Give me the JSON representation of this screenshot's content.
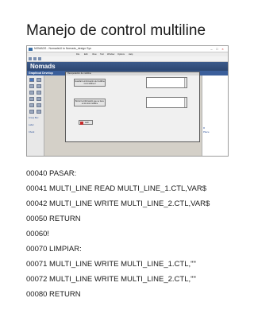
{
  "doc": {
    "title": "Manejo de control multiline"
  },
  "screenshot": {
    "window_title": "NOMADS - NomadsUI to Nomads_design Sys",
    "window_controls": [
      "–",
      "□",
      "×"
    ],
    "menu": [
      "File",
      "Edit",
      "View",
      "Tool",
      "Window",
      "Options",
      "Help"
    ],
    "app_name": "Nomads",
    "subbar_label": "Graphical Develop",
    "palette_label_1": "Group Box",
    "palette_label_2": "Label",
    "palette_label_3": "Check",
    "form_title": "Recuperación de multiline",
    "button1_label": "Guardar la información del multiline 1 al multiline 2",
    "button2_label": "Borrar la información que se tiene en los dos multiline",
    "exit_label": "salir",
    "right_panel_lines": [
      "R",
      "Place"
    ]
  },
  "code": {
    "lines": [
      "00040 PASAR:",
      "00041 MULTI_LINE READ MULTI_LINE_1.CTL,VAR$",
      "00042 MULTI_LINE WRITE MULTI_LINE_2.CTL,VAR$",
      "00050 RETURN",
      "00060!",
      "00070 LIMPIAR:",
      "00071 MULTI_LINE WRITE MULTI_LINE_1.CTL,\"\"",
      "00072 MULTI_LINE WRITE MULTI_LINE_2.CTL,\"\"",
      "00080 RETURN"
    ]
  }
}
